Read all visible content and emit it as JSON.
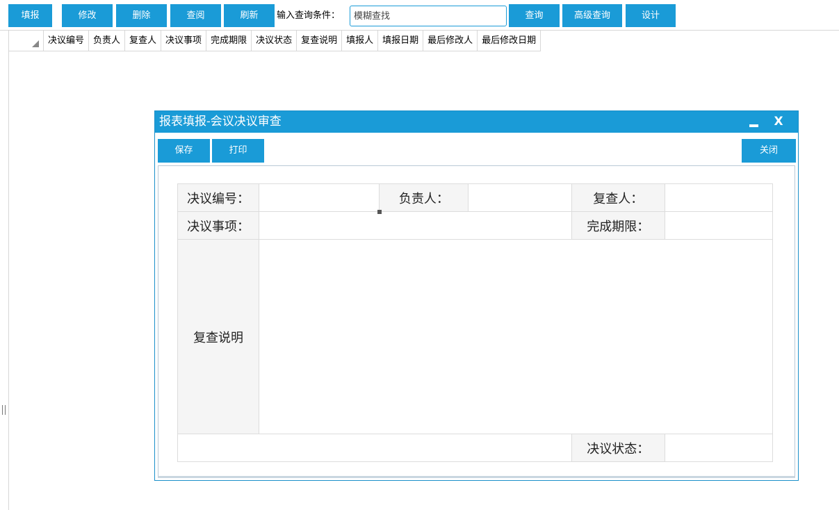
{
  "toolbar": {
    "fill_label": "填报",
    "edit_label": "修改",
    "delete_label": "删除",
    "view_label": "查阅",
    "refresh_label": "刷新",
    "search_label": "输入查询条件：",
    "search_placeholder": "模糊查找",
    "search_button_label": "查询",
    "advanced_search_label": "高级查询",
    "design_label": "设计"
  },
  "grid": {
    "columns": [
      "决议编号",
      "负责人",
      "复查人",
      "决议事项",
      "完成期限",
      "决议状态",
      "复查说明",
      "填报人",
      "填报日期",
      "最后修改人",
      "最后修改日期"
    ]
  },
  "dialog": {
    "title": "报表填报-会议决议审查",
    "save_label": "保存",
    "print_label": "打印",
    "close_label": "关闭",
    "close_glyph": "X",
    "form": {
      "resolution_no_label": "决议编号：",
      "owner_label": "负责人：",
      "reviewer_label": "复查人：",
      "matter_label": "决议事项：",
      "deadline_label": "完成期限：",
      "review_note_label": "复查说明",
      "status_label": "决议状态："
    }
  },
  "colors": {
    "accent": "#1a9bd7",
    "label_bg": "#f5f5f5",
    "border": "#dcdcdc"
  }
}
